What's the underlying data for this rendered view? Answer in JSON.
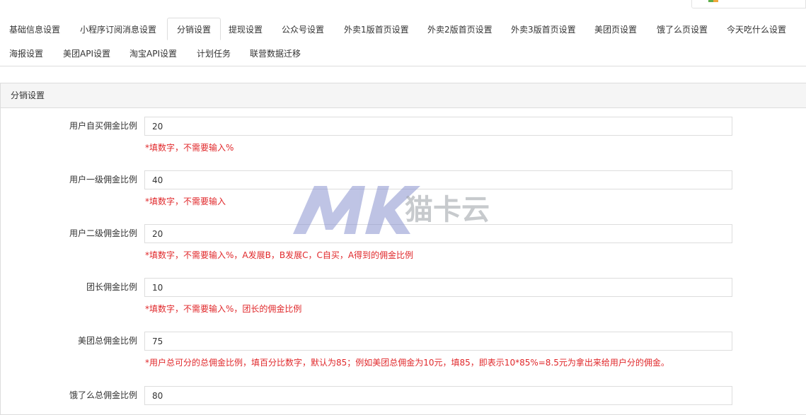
{
  "tabs": [
    {
      "label": "基础信息设置"
    },
    {
      "label": "小程序订阅消息设置"
    },
    {
      "label": "分销设置"
    },
    {
      "label": "提现设置"
    },
    {
      "label": "公众号设置"
    },
    {
      "label": "外卖1版首页设置"
    },
    {
      "label": "外卖2版首页设置"
    },
    {
      "label": "外卖3版首页设置"
    },
    {
      "label": "美团页设置"
    },
    {
      "label": "饿了么页设置"
    },
    {
      "label": "今天吃什么设置"
    },
    {
      "label": "海报设置"
    },
    {
      "label": "美团API设置"
    },
    {
      "label": "淘宝API设置"
    },
    {
      "label": "计划任务"
    },
    {
      "label": "联营数据迁移"
    }
  ],
  "active_tab": "分销设置",
  "panel": {
    "title": "分销设置"
  },
  "fields": [
    {
      "label": "用户自买佣金比例",
      "value": "20",
      "help": "*填数字，不需要输入%"
    },
    {
      "label": "用户一级佣金比例",
      "value": "40",
      "help": "*填数字，不需要输入"
    },
    {
      "label": "用户二级佣金比例",
      "value": "20",
      "help": "*填数字，不需要输入%，A发展B，B发展C，C自买，A得到的佣金比例"
    },
    {
      "label": "团长佣金比例",
      "value": "10",
      "help": "*填数字，不需要输入%，团长的佣金比例"
    },
    {
      "label": "美团总佣金比例",
      "value": "75",
      "help": "*用户总可分的总佣金比例，填百分比数字，默认为85；例如美团总佣金为10元，填85，即表示10*85%=8.5元为拿出来给用户分的佣金。"
    },
    {
      "label": "饿了么总佣金比例",
      "value": "80",
      "help": ""
    }
  ],
  "watermark": {
    "logo": "MK",
    "text": "猫卡云"
  },
  "colors": {
    "help_text": "#e0282b",
    "heading_bg": "#f5f5f5",
    "border": "#dddddd",
    "watermark": "#7d86c4"
  }
}
